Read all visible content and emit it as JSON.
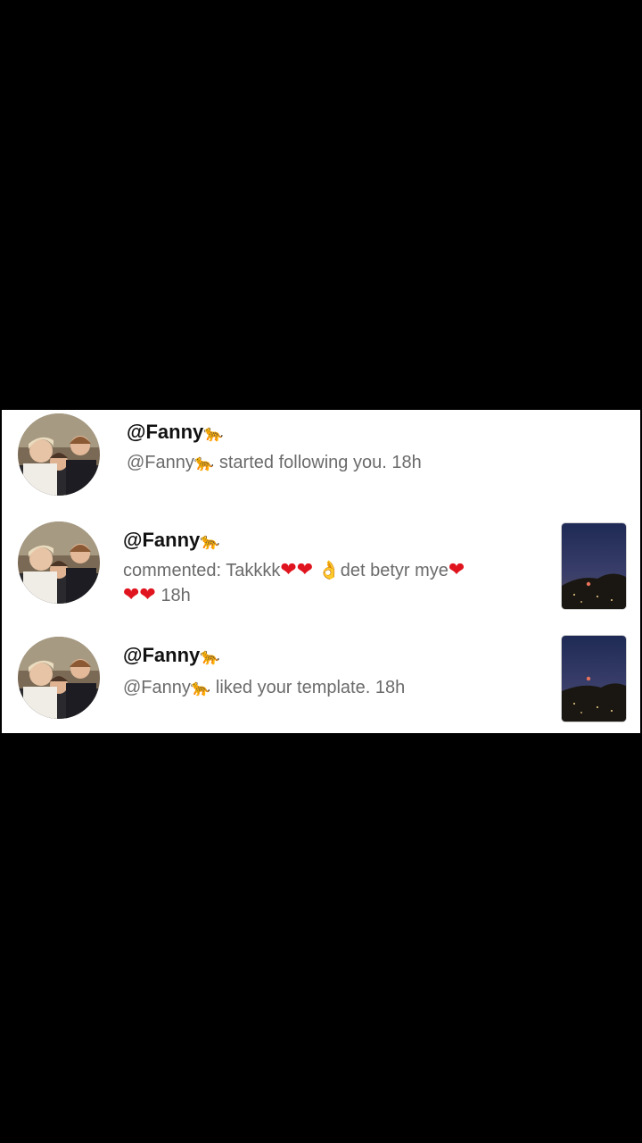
{
  "notifications": [
    {
      "username": "@Fanny",
      "username_emoji": "🐆",
      "actor": "@Fanny",
      "actor_emoji": "🐆",
      "text": "started following you.",
      "time": "18h",
      "avatar_icon": "avatar-photo-icon"
    },
    {
      "username": "@Fanny",
      "username_emoji": "🐆",
      "prefix": "commented: Takkkk",
      "hearts_a": "❤❤",
      "hand": "👌",
      "middle": "det betyr mye",
      "hearts_b": "❤",
      "hearts_c": "❤❤",
      "time": "18h",
      "avatar_icon": "avatar-photo-icon",
      "thumbnail_icon": "night-sky-thumbnail-icon"
    },
    {
      "username": "@Fanny",
      "username_emoji": "🐆",
      "actor": "@Fanny",
      "actor_emoji": "🐆",
      "text": "liked your template.",
      "time": "18h",
      "avatar_icon": "avatar-photo-icon",
      "thumbnail_icon": "night-sky-thumbnail-icon"
    }
  ],
  "colors": {
    "background": "#000000",
    "panel": "#ffffff",
    "username": "#111111",
    "secondary_text": "#6b6b6b",
    "heart": "#e0141e"
  }
}
